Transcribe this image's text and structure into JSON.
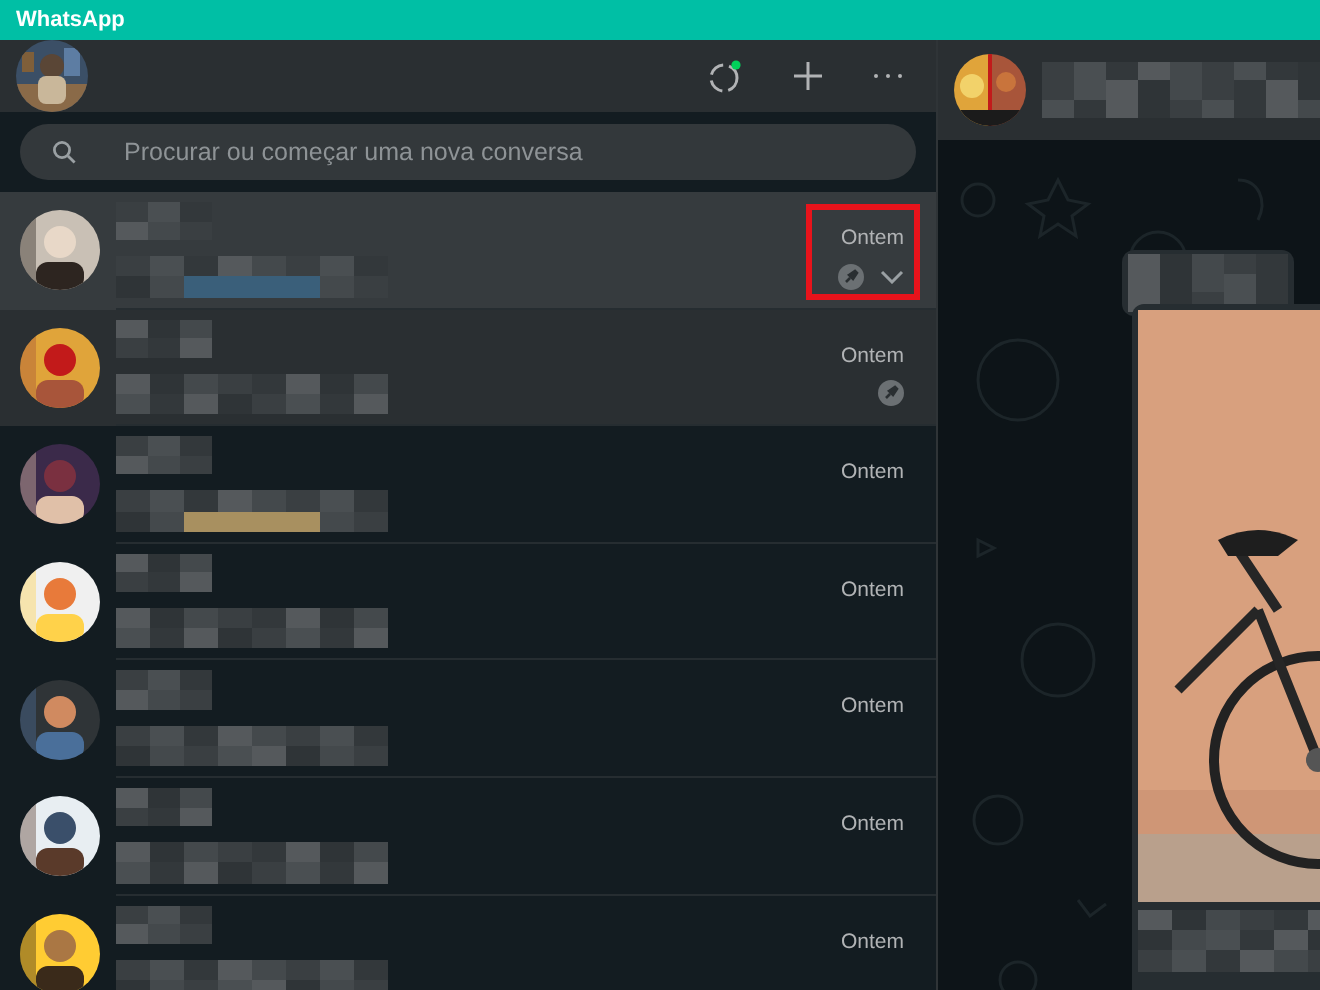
{
  "window": {
    "title": "WhatsApp"
  },
  "search": {
    "placeholder": "Procurar ou começar uma nova conversa"
  },
  "chats": [
    {
      "time": "Ontem",
      "pinned": true,
      "hovered": true,
      "selected": false,
      "highlighted": true
    },
    {
      "time": "Ontem",
      "pinned": true,
      "hovered": false,
      "selected": true,
      "highlighted": false
    },
    {
      "time": "Ontem",
      "pinned": false,
      "hovered": false,
      "selected": false,
      "highlighted": false
    },
    {
      "time": "Ontem",
      "pinned": false,
      "hovered": false,
      "selected": false,
      "highlighted": false
    },
    {
      "time": "Ontem",
      "pinned": false,
      "hovered": false,
      "selected": false,
      "highlighted": false
    },
    {
      "time": "Ontem",
      "pinned": false,
      "hovered": false,
      "selected": false,
      "highlighted": false
    },
    {
      "time": "Ontem",
      "pinned": false,
      "hovered": false,
      "selected": false,
      "highlighted": false
    }
  ]
}
